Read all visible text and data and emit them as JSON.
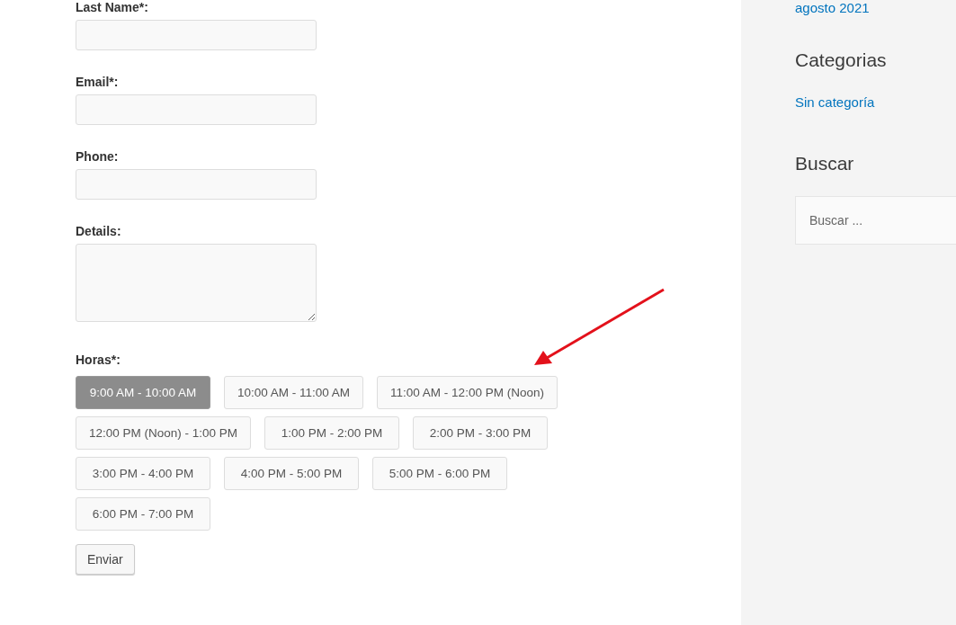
{
  "form": {
    "fields": [
      {
        "label": "Last Name*:",
        "kind": "input"
      },
      {
        "label": "Email*:",
        "kind": "input"
      },
      {
        "label": "Phone:",
        "kind": "input"
      },
      {
        "label": "Details:",
        "kind": "textarea"
      }
    ],
    "hours": {
      "label": "Horas*:",
      "slots": [
        {
          "text": "9:00 AM - 10:00 AM",
          "selected": true
        },
        {
          "text": "10:00 AM - 11:00 AM",
          "selected": false
        },
        {
          "text": "11:00 AM - 12:00 PM (Noon)",
          "selected": false
        },
        {
          "text": "12:00 PM (Noon) - 1:00 PM",
          "selected": false
        },
        {
          "text": "1:00 PM - 2:00 PM",
          "selected": false
        },
        {
          "text": "2:00 PM - 3:00 PM",
          "selected": false
        },
        {
          "text": "3:00 PM - 4:00 PM",
          "selected": false
        },
        {
          "text": "4:00 PM - 5:00 PM",
          "selected": false
        },
        {
          "text": "5:00 PM - 6:00 PM",
          "selected": false
        },
        {
          "text": "6:00 PM - 7:00 PM",
          "selected": false
        }
      ]
    },
    "submit": "Enviar"
  },
  "sidebar": {
    "archive_link": "agosto 2021",
    "categories": {
      "title": "Categorias",
      "items": [
        "Sin categoría"
      ]
    },
    "search": {
      "title": "Buscar",
      "placeholder": "Buscar ..."
    }
  }
}
